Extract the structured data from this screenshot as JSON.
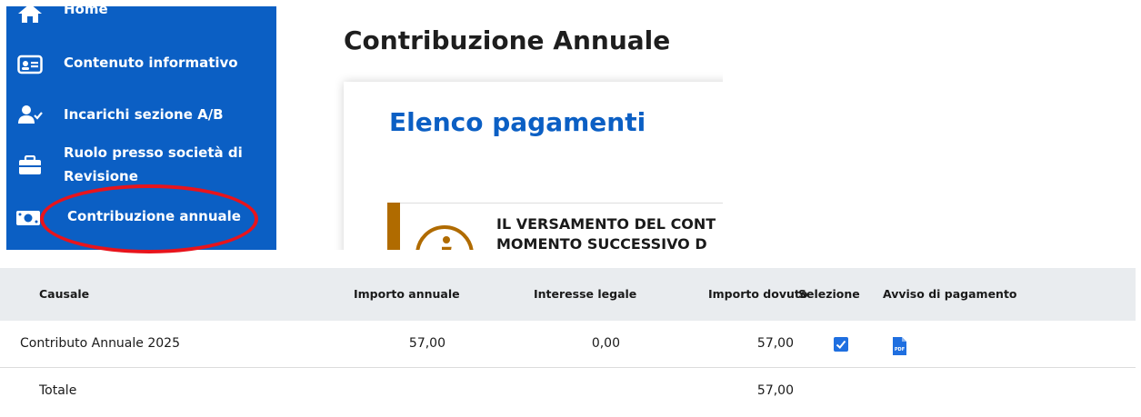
{
  "sidebar": {
    "items": [
      {
        "label": "Home",
        "icon": "home-icon"
      },
      {
        "label": "Contenuto informativo",
        "icon": "id-card-icon"
      },
      {
        "label": "Incarichi sezione A/B",
        "icon": "user-check-icon"
      },
      {
        "label": "Ruolo presso società di",
        "label2": "Revisione",
        "icon": "briefcase-icon"
      },
      {
        "label": "Contribuzione annuale",
        "icon": "money-icon"
      }
    ],
    "bg_color": "#0b5fc4"
  },
  "page": {
    "title": "Contribuzione Annuale"
  },
  "card": {
    "title": "Elenco pagamenti",
    "alert_line1": "IL VERSAMENTO DEL CONT",
    "alert_line2": "MOMENTO SUCCESSIVO D"
  },
  "table": {
    "headers": {
      "causale": "Causale",
      "importo_annuale": "Importo annuale",
      "interesse_legale": "Interesse legale",
      "importo_dovuto": "Importo dovuto",
      "selezione": "Selezione",
      "avviso": "Avviso di pagamento"
    },
    "rows": [
      {
        "causale": "Contributo Annuale 2025",
        "importo_annuale": "57,00",
        "interesse_legale": "0,00",
        "importo_dovuto": "57,00",
        "selezione_checked": true,
        "avviso_icon": "pdf-icon"
      }
    ],
    "totale": {
      "label": "Totale",
      "importo_dovuto": "57,00"
    }
  },
  "colors": {
    "accent": "#0b5fc4",
    "highlight": "#e8141c",
    "alert_bar": "#b06b00",
    "checkbox": "#1f6fe0"
  }
}
